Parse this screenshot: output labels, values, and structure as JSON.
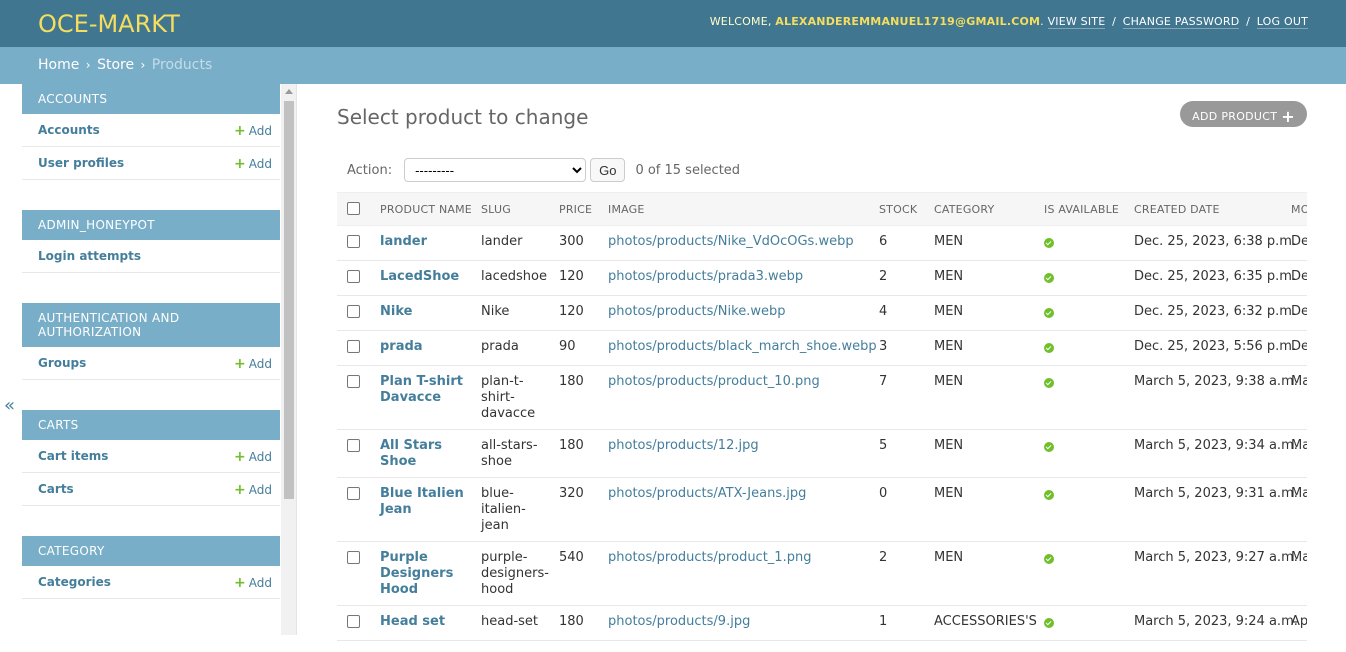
{
  "header": {
    "brand": "OCE-MARKT",
    "welcome": "WELCOME,",
    "user_email": "ALEXANDEREMMANUEL1719@GMAIL.COM",
    "period": ".",
    "view_site": "VIEW SITE",
    "change_password": "CHANGE PASSWORD",
    "log_out": "LOG OUT",
    "separator": "/"
  },
  "breadcrumbs": {
    "home": "Home",
    "store": "Store",
    "current": "Products",
    "arrow": "›"
  },
  "sidebar": {
    "add_label": "Add",
    "toggle": "«",
    "modules": [
      {
        "caption": "ACCOUNTS",
        "models": [
          {
            "name": "Accounts",
            "add": true
          },
          {
            "name": "User profiles",
            "add": true
          }
        ]
      },
      {
        "caption": "ADMIN_HONEYPOT",
        "models": [
          {
            "name": "Login attempts",
            "add": false
          }
        ]
      },
      {
        "caption": "AUTHENTICATION AND AUTHORIZATION",
        "models": [
          {
            "name": "Groups",
            "add": true
          }
        ]
      },
      {
        "caption": "CARTS",
        "models": [
          {
            "name": "Cart items",
            "add": true
          },
          {
            "name": "Carts",
            "add": true
          }
        ]
      },
      {
        "caption": "CATEGORY",
        "models": [
          {
            "name": "Categories",
            "add": true
          }
        ]
      }
    ]
  },
  "content": {
    "title": "Select product to change",
    "add_button": "ADD PRODUCT",
    "action_label": "Action:",
    "action_select": "---------",
    "go_button": "Go",
    "selection_counter": "0 of 15 selected",
    "columns": [
      "PRODUCT NAME",
      "SLUG",
      "PRICE",
      "IMAGE",
      "STOCK",
      "CATEGORY",
      "IS AVAILABLE",
      "CREATED DATE",
      "MO"
    ],
    "rows": [
      {
        "name": "lander",
        "slug": "lander",
        "price": "300",
        "image": "photos/products/Nike_VdOcOGs.webp",
        "stock": "6",
        "category": "MEN",
        "created": "Dec. 25, 2023, 6:38 p.m.",
        "modified": "Dec"
      },
      {
        "name": "LacedShoe",
        "slug": "lacedshoe",
        "price": "120",
        "image": "photos/products/prada3.webp",
        "stock": "2",
        "category": "MEN",
        "created": "Dec. 25, 2023, 6:35 p.m.",
        "modified": "Dec"
      },
      {
        "name": "Nike",
        "slug": "Nike",
        "price": "120",
        "image": "photos/products/Nike.webp",
        "stock": "4",
        "category": "MEN",
        "created": "Dec. 25, 2023, 6:32 p.m.",
        "modified": "Dec"
      },
      {
        "name": "prada",
        "slug": "prada",
        "price": "90",
        "image": "photos/products/black_march_shoe.webp",
        "stock": "3",
        "category": "MEN",
        "created": "Dec. 25, 2023, 5:56 p.m.",
        "modified": "Dec"
      },
      {
        "name": "Plan T-shirt Davacce",
        "slug": "plan-t-shirt-davacce",
        "price": "180",
        "image": "photos/products/product_10.png",
        "stock": "7",
        "category": "MEN",
        "created": "March 5, 2023, 9:38 a.m.",
        "modified": "Ma"
      },
      {
        "name": "All Stars Shoe",
        "slug": "all-stars-shoe",
        "price": "180",
        "image": "photos/products/12.jpg",
        "stock": "5",
        "category": "MEN",
        "created": "March 5, 2023, 9:34 a.m.",
        "modified": "Ma"
      },
      {
        "name": "Blue Italien Jean",
        "slug": "blue-italien-jean",
        "price": "320",
        "image": "photos/products/ATX-Jeans.jpg",
        "stock": "0",
        "category": "MEN",
        "created": "March 5, 2023, 9:31 a.m.",
        "modified": "Ma"
      },
      {
        "name": "Purple Designers Hood",
        "slug": "purple-designers-hood",
        "price": "540",
        "image": "photos/products/product_1.png",
        "stock": "2",
        "category": "MEN",
        "created": "March 5, 2023, 9:27 a.m.",
        "modified": "Ma"
      },
      {
        "name": "Head set",
        "slug": "head-set",
        "price": "180",
        "image": "photos/products/9.jpg",
        "stock": "1",
        "category": "ACCESSORIES'S",
        "created": "March 5, 2023, 9:24 a.m.",
        "modified": "Apr"
      }
    ]
  },
  "colors": {
    "header_bg": "#417690",
    "breadcrumb_bg": "#79aec8",
    "brand": "#f5dd5d",
    "link": "#447e9b",
    "available": "#70bf2b"
  }
}
